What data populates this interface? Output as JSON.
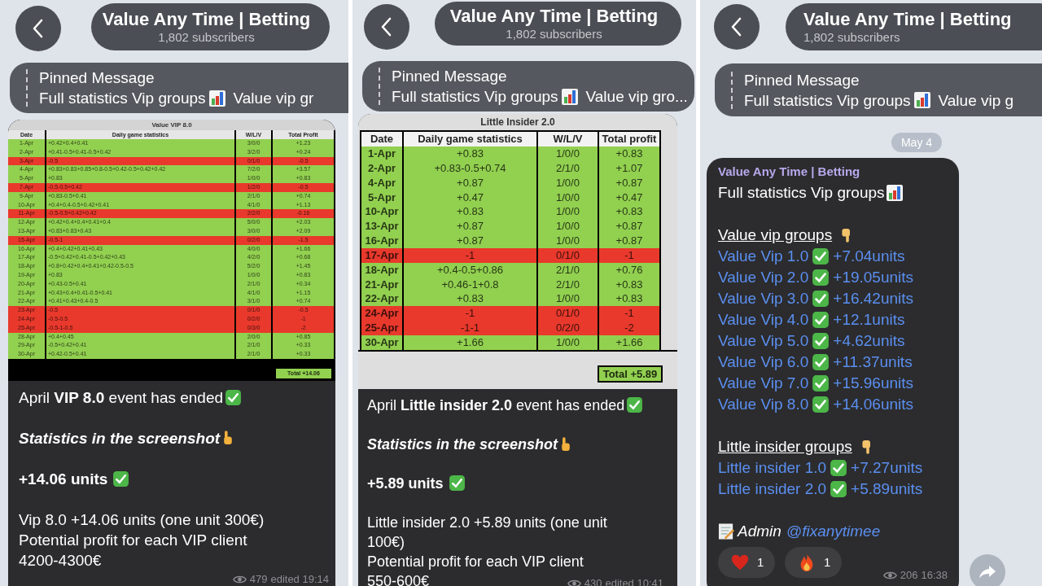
{
  "panels": [
    {
      "header": {
        "title": "Value Any Time | Betting",
        "subtitle": "1,802 subscribers"
      },
      "pinned": {
        "label": "Pinned Message",
        "preview_start": "Full statistics Vip groups",
        "preview_end": "Value vip gr"
      },
      "message": {
        "kind": "report",
        "table": {
          "title": "Value VIP 8.0",
          "columns": [
            "Date",
            "Daily game statistics",
            "W/L/V",
            "Total Profit"
          ],
          "rows": [
            {
              "cells": [
                "1-Apr",
                "+0.42+0.4+0.41",
                "3/0/0",
                "+1.23"
              ],
              "color": "#92d050"
            },
            {
              "cells": [
                "2-Apr",
                "+0.41-0.5+0.41-0.5+0.42",
                "3/2/0",
                "+0.24"
              ],
              "color": "#92d050"
            },
            {
              "cells": [
                "3-Apr",
                "-0.5",
                "0/1/0",
                "-0.5"
              ],
              "color": "#e8392c"
            },
            {
              "cells": [
                "4-Apr",
                "+0.83+0.83+0.85+0.8-0.5+0.42-0.5+0.42+0.42",
                "7/2/0",
                "+3.57"
              ],
              "color": "#92d050"
            },
            {
              "cells": [
                "5-Apr",
                "+0.83",
                "1/0/0",
                "+0.83"
              ],
              "color": "#92d050"
            },
            {
              "cells": [
                "7-Apr",
                "-0.5-0.5+0.42",
                "1/2/0",
                "-0.5"
              ],
              "color": "#e8392c"
            },
            {
              "cells": [
                "9-Apr",
                "+0.83-0.5+0.41",
                "2/1/0",
                "+0.74"
              ],
              "color": "#92d050"
            },
            {
              "cells": [
                "10-Apr",
                "+0.4+0.4-0.5+0.42+0.41",
                "4/1/0",
                "+1.13"
              ],
              "color": "#92d050"
            },
            {
              "cells": [
                "11-Apr",
                "-0.5-0.5+0.42+0.42",
                "2/2/0",
                "-0.16"
              ],
              "color": "#e8392c"
            },
            {
              "cells": [
                "12-Apr",
                "+0.42+0.4+0.4+0.41+0.4",
                "5/0/0",
                "+2.03"
              ],
              "color": "#92d050"
            },
            {
              "cells": [
                "13-Apr",
                "+0.83+0.83+0.43",
                "3/0/0",
                "+2.09"
              ],
              "color": "#92d050"
            },
            {
              "cells": [
                "15-Apr",
                "-0.5-1",
                "0/2/0",
                "-1.5"
              ],
              "color": "#e8392c"
            },
            {
              "cells": [
                "16-Apr",
                "+0.4+0.42+0.41+0.43",
                "4/0/0",
                "+1.66"
              ],
              "color": "#92d050"
            },
            {
              "cells": [
                "17-Apr",
                "-0.5+0.42+0.41-0.5+0.42+0.43",
                "4/2/0",
                "+0.68"
              ],
              "color": "#92d050"
            },
            {
              "cells": [
                "18-Apr",
                "+0.8+0.42+0.4+0.41+0.42-0.5-0.5",
                "5/2/0",
                "+1.45"
              ],
              "color": "#92d050"
            },
            {
              "cells": [
                "19-Apr",
                "+0.83",
                "1/0/0",
                "+0.83"
              ],
              "color": "#92d050"
            },
            {
              "cells": [
                "20-Apr",
                "+0.43-0.5+0.41",
                "2/1/0",
                "+0.34"
              ],
              "color": "#92d050"
            },
            {
              "cells": [
                "21-Apr",
                "+0.43+0.4+0.41-0.5+0.41",
                "4/1/0",
                "+1.15"
              ],
              "color": "#92d050"
            },
            {
              "cells": [
                "22-Apr",
                "+0.41+0.43+0.4-0.5",
                "3/1/0",
                "+0.74"
              ],
              "color": "#92d050"
            },
            {
              "cells": [
                "23-Apr",
                "-0.5",
                "0/1/0",
                "-0.5"
              ],
              "color": "#e8392c"
            },
            {
              "cells": [
                "24-Apr",
                "-0.5-0.5",
                "0/2/0",
                "-1"
              ],
              "color": "#e8392c"
            },
            {
              "cells": [
                "25-Apr",
                "-0.5-1-0.5",
                "0/3/0",
                "-2"
              ],
              "color": "#e8392c"
            },
            {
              "cells": [
                "28-Apr",
                "+0.4+0.45",
                "2/0/0",
                "+0.85"
              ],
              "color": "#92d050"
            },
            {
              "cells": [
                "29-Apr",
                "-0.5+0.42+0.41",
                "2/1/0",
                "+0.33"
              ],
              "color": "#92d050"
            },
            {
              "cells": [
                "30-Apr",
                "+0.42-0.5+0.41",
                "2/1/0",
                "+0.33"
              ],
              "color": "#92d050"
            }
          ],
          "total": "Total +14.06"
        },
        "headline": "April **VIP 8.0** event has ended",
        "note": "Statistics in the screenshot",
        "result": "+14.06 units",
        "details": [
          "Vip 8.0 +14.06 units (one unit 300€)",
          "Potential profit for each VIP client",
          "4200-4300€"
        ],
        "views": "479",
        "time": "edited 19:14"
      }
    },
    {
      "header": {
        "title": "Value Any Time | Betting",
        "subtitle": "1,802 subscribers"
      },
      "pinned": {
        "label": "Pinned Message",
        "preview_start": "Full statistics Vip groups",
        "preview_end": "Value vip gro..."
      },
      "message": {
        "kind": "report",
        "table": {
          "title": "Little Insider 2.0",
          "columns": [
            "Date",
            "Daily game statistics",
            "W/L/V",
            "Total profit"
          ],
          "rows": [
            {
              "cells": [
                "1-Apr",
                "+0.83",
                "1/0/0",
                "+0.83"
              ],
              "color": "#92d050"
            },
            {
              "cells": [
                "2-Apr",
                "+0.83-0.5+0.74",
                "2/1/0",
                "+1.07"
              ],
              "color": "#92d050"
            },
            {
              "cells": [
                "4-Apr",
                "+0.87",
                "1/0/0",
                "+0.87"
              ],
              "color": "#92d050"
            },
            {
              "cells": [
                "5-Apr",
                "+0.47",
                "1/0/0",
                "+0.47"
              ],
              "color": "#92d050"
            },
            {
              "cells": [
                "10-Apr",
                "+0.83",
                "1/0/0",
                "+0.83"
              ],
              "color": "#92d050"
            },
            {
              "cells": [
                "13-Apr",
                "+0.87",
                "1/0/0",
                "+0.87"
              ],
              "color": "#92d050"
            },
            {
              "cells": [
                "16-Apr",
                "+0.87",
                "1/0/0",
                "+0.87"
              ],
              "color": "#92d050"
            },
            {
              "cells": [
                "17-Apr",
                "-1",
                "0/1/0",
                "-1"
              ],
              "color": "#e8392c"
            },
            {
              "cells": [
                "18-Apr",
                "+0.4-0.5+0.86",
                "2/1/0",
                "+0.76"
              ],
              "color": "#92d050"
            },
            {
              "cells": [
                "21-Apr",
                "+0.46-1+0.8",
                "2/1/0",
                "+0.83"
              ],
              "color": "#92d050"
            },
            {
              "cells": [
                "22-Apr",
                "+0.83",
                "1/0/0",
                "+0.83"
              ],
              "color": "#92d050"
            },
            {
              "cells": [
                "24-Apr",
                "-1",
                "0/1/0",
                "-1"
              ],
              "color": "#e8392c"
            },
            {
              "cells": [
                "25-Apr",
                "-1-1",
                "0/2/0",
                "-2"
              ],
              "color": "#e8392c"
            },
            {
              "cells": [
                "30-Apr",
                "+1.66",
                "1/0/0",
                "+1.66"
              ],
              "color": "#92d050"
            }
          ],
          "total": "Total +5.89"
        },
        "headline": "April **Little insider 2.0** event has ended",
        "note": "Statistics in the screenshot",
        "result": "+5.89 units",
        "details": [
          "Little insider 2.0 +5.89 units (one unit",
          "100€)",
          "Potential profit for each VIP client",
          "550-600€"
        ],
        "views": "430",
        "time": "edited 10:41"
      }
    },
    {
      "header": {
        "title": "Value Any Time | Betting",
        "subtitle": "1,802 subscribers"
      },
      "pinned": {
        "label": "Pinned Message",
        "preview_start": "Full statistics Vip groups",
        "preview_end": "Value vip g"
      },
      "date": "May 4",
      "message": {
        "kind": "summary",
        "sender": "Value Any Time | Betting",
        "title": "Full statistics Vip groups",
        "sections": [
          {
            "heading": "Value vip groups",
            "groups": [
              {
                "label": "Value Vip 1.0",
                "value": "+7.04units"
              },
              {
                "label": "Value Vip 2.0",
                "value": "+19.05units"
              },
              {
                "label": "Value Vip 3.0",
                "value": "+16.42units"
              },
              {
                "label": "Value Vip 4.0",
                "value": "+12.1units"
              },
              {
                "label": "Value Vip 5.0",
                "value": "+4.62units"
              },
              {
                "label": "Value Vip 6.0",
                "value": "+11.37units"
              },
              {
                "label": "Value Vip 7.0",
                "value": "+15.96units"
              },
              {
                "label": "Value Vip 8.0",
                "value": "+14.06units"
              }
            ]
          },
          {
            "heading": "Little insider groups",
            "groups": [
              {
                "label": "Little insider 1.0",
                "value": "+7.27units"
              },
              {
                "label": "Little insider 2.0",
                "value": "+5.89units"
              }
            ]
          }
        ],
        "admin": {
          "label": "Admin",
          "handle": "@fixanytimee"
        },
        "reactions": [
          {
            "kind": "heart",
            "count": "1"
          },
          {
            "kind": "fire",
            "count": "1"
          }
        ],
        "views": "206",
        "time": "16:38"
      }
    }
  ]
}
